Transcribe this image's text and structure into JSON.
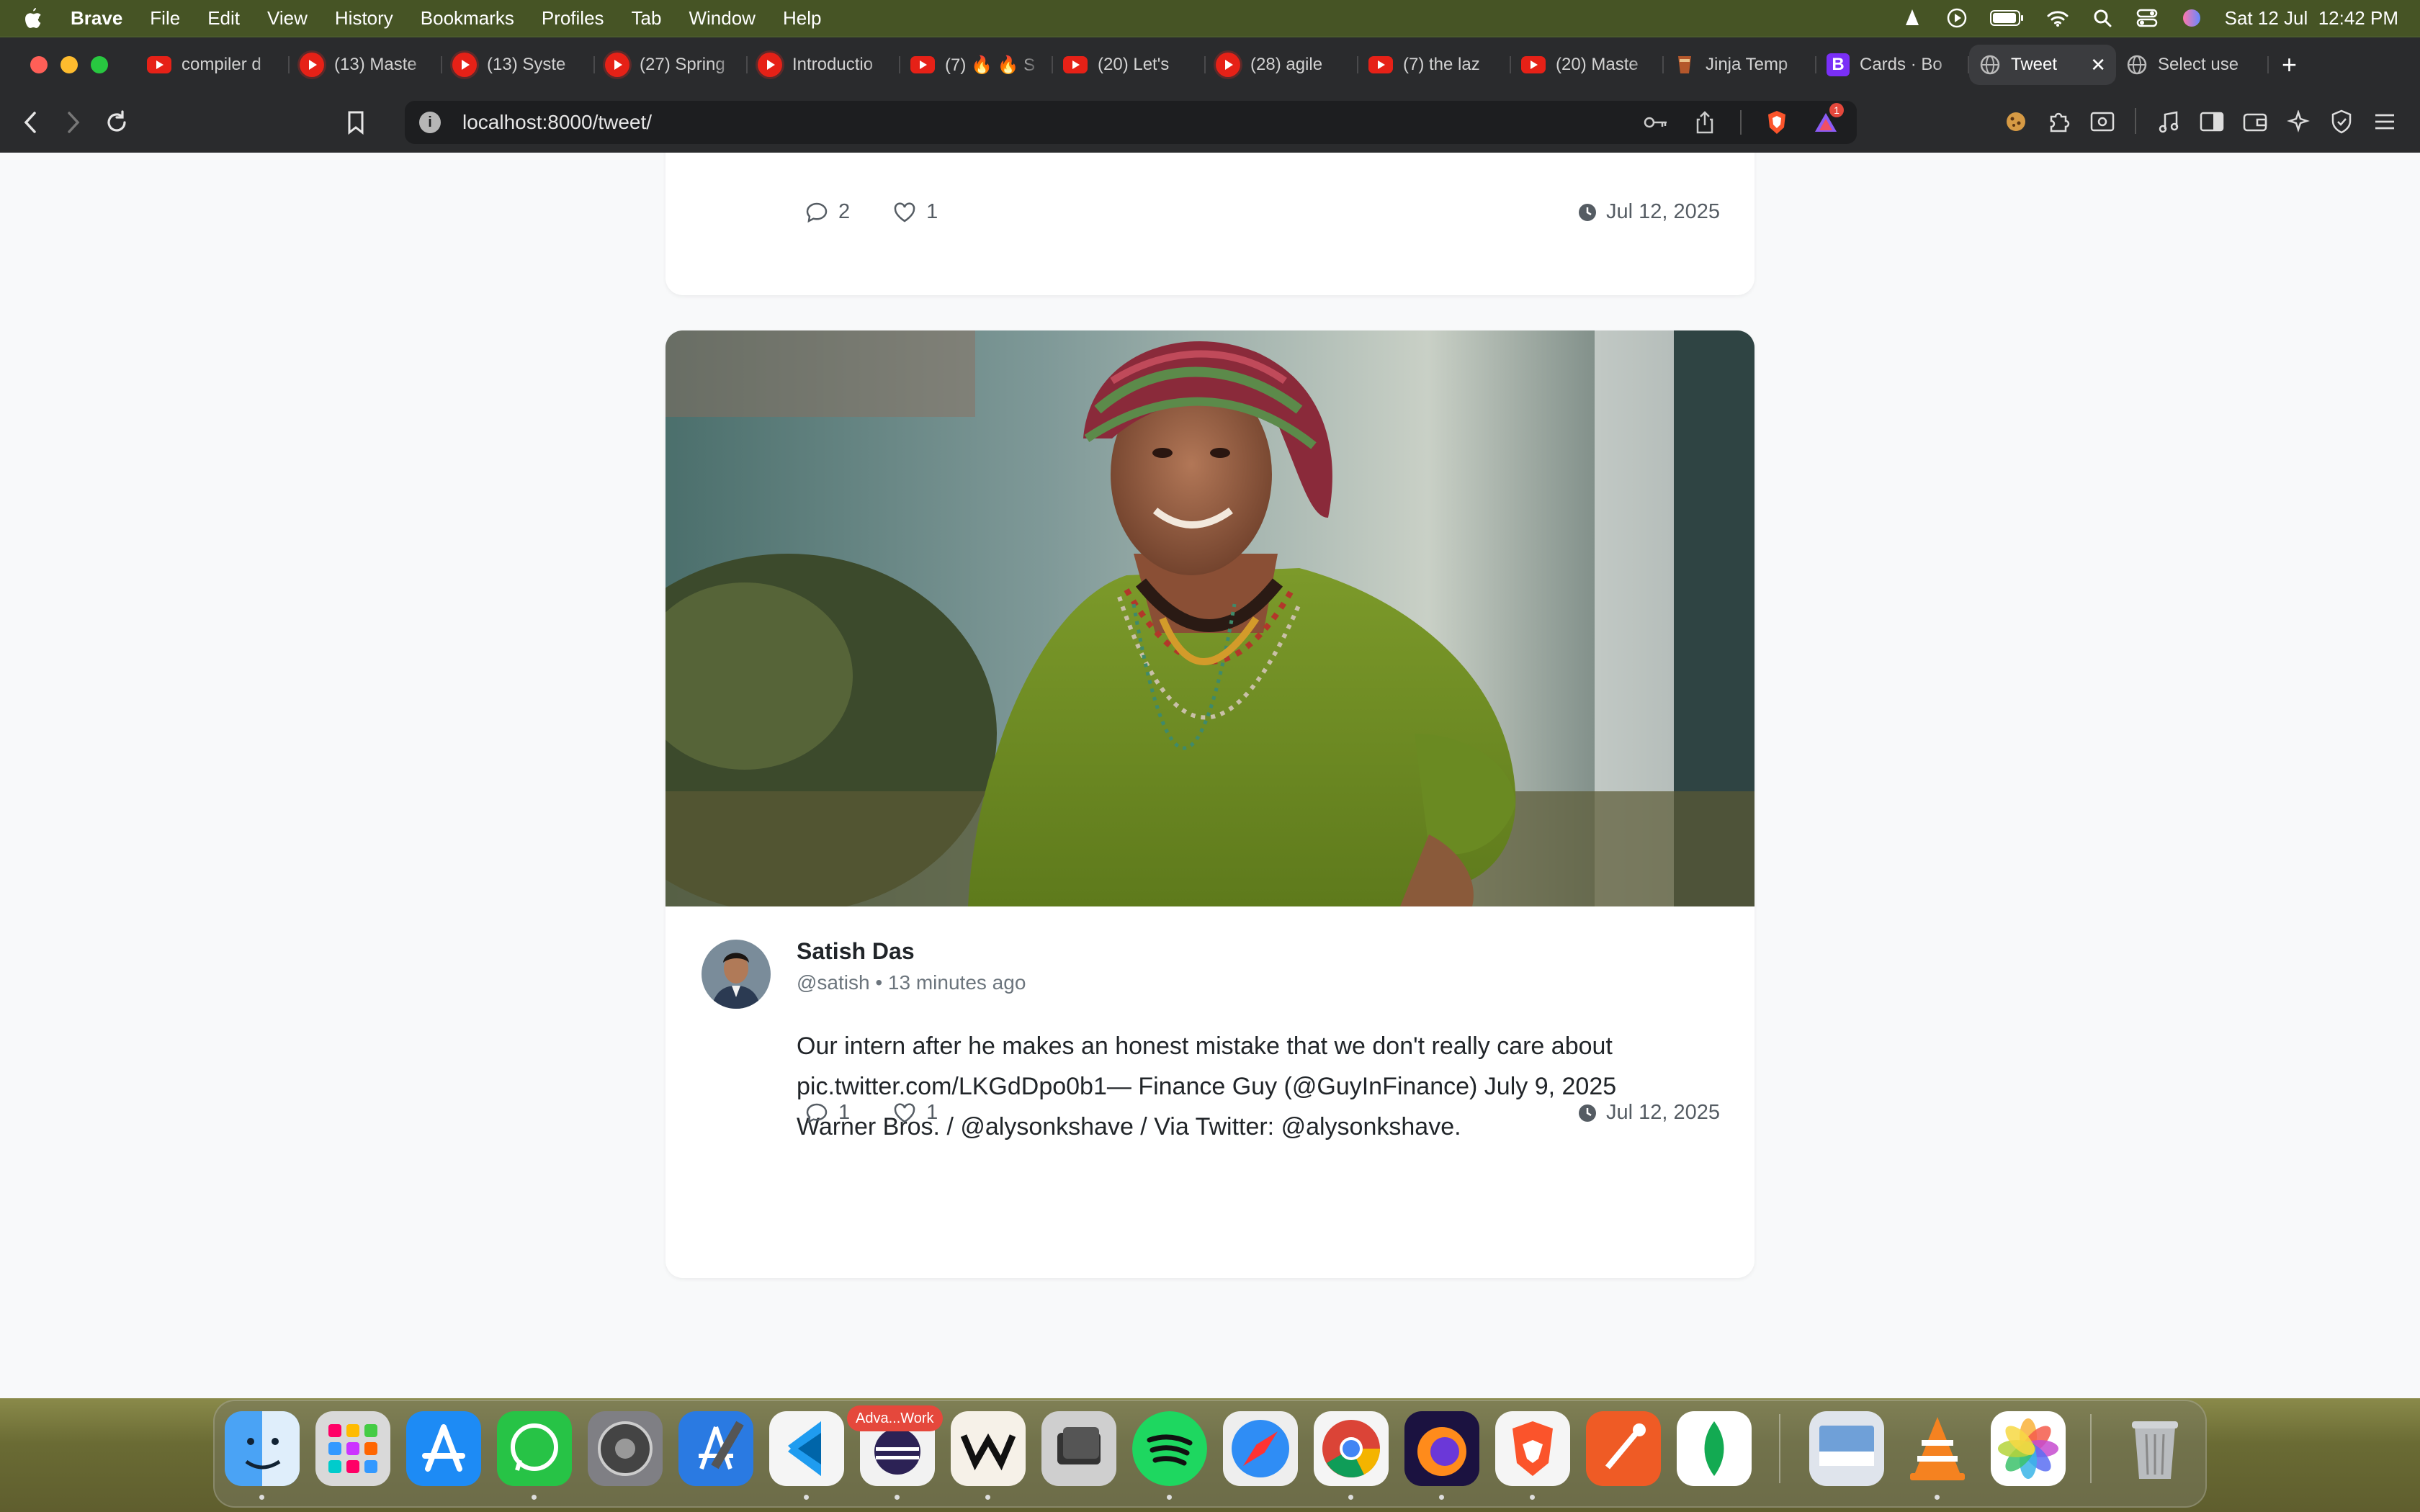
{
  "menubar": {
    "app_name": "Brave",
    "items": [
      "File",
      "Edit",
      "View",
      "History",
      "Bookmarks",
      "Profiles",
      "Tab",
      "Window",
      "Help"
    ],
    "clock": "Sat 12 Jul  12:42 PM"
  },
  "tabs": [
    {
      "label": "compiler d",
      "icon": "youtube-icon"
    },
    {
      "label": "(13) Maste",
      "icon": "youtube-icon"
    },
    {
      "label": "(13) Syste",
      "icon": "youtube-icon"
    },
    {
      "label": "(27) Spring",
      "icon": "youtube-icon"
    },
    {
      "label": "Introductio",
      "icon": "youtube-icon"
    },
    {
      "label": "(7) 🔥 🔥 S",
      "icon": "youtube-icon"
    },
    {
      "label": "(20) Let's",
      "icon": "youtube-icon"
    },
    {
      "label": "(28) agile",
      "icon": "youtube-icon"
    },
    {
      "label": "(7) the laz",
      "icon": "youtube-icon"
    },
    {
      "label": "(20) Maste",
      "icon": "youtube-icon"
    },
    {
      "label": "Jinja Temp",
      "icon": "jinja-icon"
    },
    {
      "label": "Cards · Bo",
      "icon": "bootstrap-icon"
    },
    {
      "label": "Tweet",
      "icon": "globe-icon",
      "active": true
    },
    {
      "label": "Select use",
      "icon": "globe-icon"
    }
  ],
  "address": {
    "url": "localhost:8000/tweet/",
    "shield_badge": "1"
  },
  "top_card": {
    "comments": "2",
    "likes": "1",
    "date": "Jul 12, 2025"
  },
  "tweet": {
    "author_name": "Satish Das",
    "handle_time": "@satish • 13 minutes ago",
    "text_lines": [
      "Our intern after he makes an honest mistake that we don't really care about",
      "pic.twitter.com/LKGdDpo0b1— Finance Guy (@GuyInFinance) July 9, 2025",
      "Warner Bros. / @alysonkshave / Via Twitter: @alysonkshave."
    ],
    "comments": "1",
    "likes": "1",
    "date": "Jul 12, 2025"
  },
  "dock": {
    "badge_label": "Adva...Work",
    "apps": [
      "finder-icon",
      "launchpad-icon",
      "app-store-icon",
      "whatsapp-icon",
      "system-settings-icon",
      "xcode-icon",
      "vscode-icon",
      "eclipse-icon",
      "warp-icon",
      "parallels-icon",
      "spotify-icon",
      "safari-icon",
      "chrome-icon",
      "firefox-icon",
      "brave-icon",
      "postman-icon",
      "mongodb-icon",
      "preview-icon",
      "vlc-icon",
      "photos-icon",
      "trash-icon"
    ]
  }
}
